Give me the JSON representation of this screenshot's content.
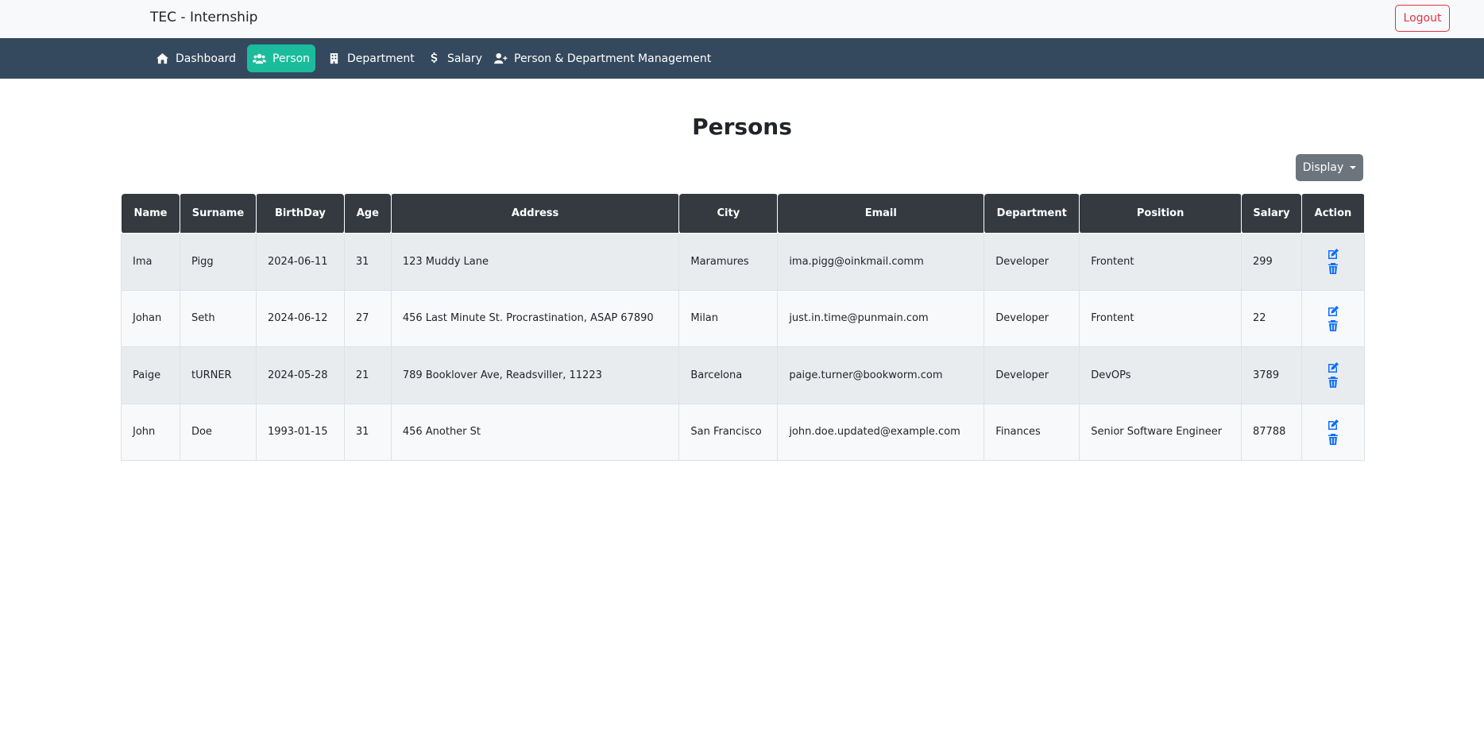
{
  "header": {
    "brand": "TEC - Internship",
    "logout_label": "Logout"
  },
  "nav": {
    "items": [
      {
        "label": "Dashboard",
        "icon": "home-icon",
        "active": false
      },
      {
        "label": "Person",
        "icon": "users-icon",
        "active": true
      },
      {
        "label": "Department",
        "icon": "building-icon",
        "active": false
      },
      {
        "label": "Salary",
        "icon": "dollar-icon",
        "active": false
      },
      {
        "label": "Person & Department Management",
        "icon": "user-plus-icon",
        "active": false
      }
    ]
  },
  "page": {
    "title": "Persons",
    "display_label": "Display"
  },
  "table": {
    "columns": [
      "Name",
      "Surname",
      "BirthDay",
      "Age",
      "Address",
      "City",
      "Email",
      "Department",
      "Position",
      "Salary",
      "Action"
    ],
    "rows": [
      {
        "name": "Ima",
        "surname": "Pigg",
        "birthday": "2024-06-11",
        "age": "31",
        "address": "123 Muddy Lane",
        "city": "Maramures",
        "email": "ima.pigg@oinkmail.comm",
        "department": "Developer",
        "position": "Frontent",
        "salary": "299"
      },
      {
        "name": "Johan",
        "surname": "Seth",
        "birthday": "2024-06-12",
        "age": "27",
        "address": "456 Last Minute St. Procrastination, ASAP 67890",
        "city": "Milan",
        "email": "just.in.time@punmain.com",
        "department": "Developer",
        "position": "Frontent",
        "salary": "22"
      },
      {
        "name": "Paige",
        "surname": "tURNER",
        "birthday": "2024-05-28",
        "age": "21",
        "address": "789 Booklover Ave, Readsviller, 11223",
        "city": "Barcelona",
        "email": "paige.turner@bookworm.com",
        "department": "Developer",
        "position": "DevOPs",
        "salary": "3789"
      },
      {
        "name": "John",
        "surname": "Doe",
        "birthday": "1993-01-15",
        "age": "31",
        "address": "456 Another St",
        "city": "San Francisco",
        "email": "john.doe.updated@example.com",
        "department": "Finances",
        "position": "Senior Software Engineer",
        "salary": "87788"
      }
    ]
  },
  "colors": {
    "navbar": "#34495e",
    "active": "#1abc9c",
    "table_head": "#343a40",
    "action_icon": "#0d6efd",
    "logout": "#dc3545"
  }
}
